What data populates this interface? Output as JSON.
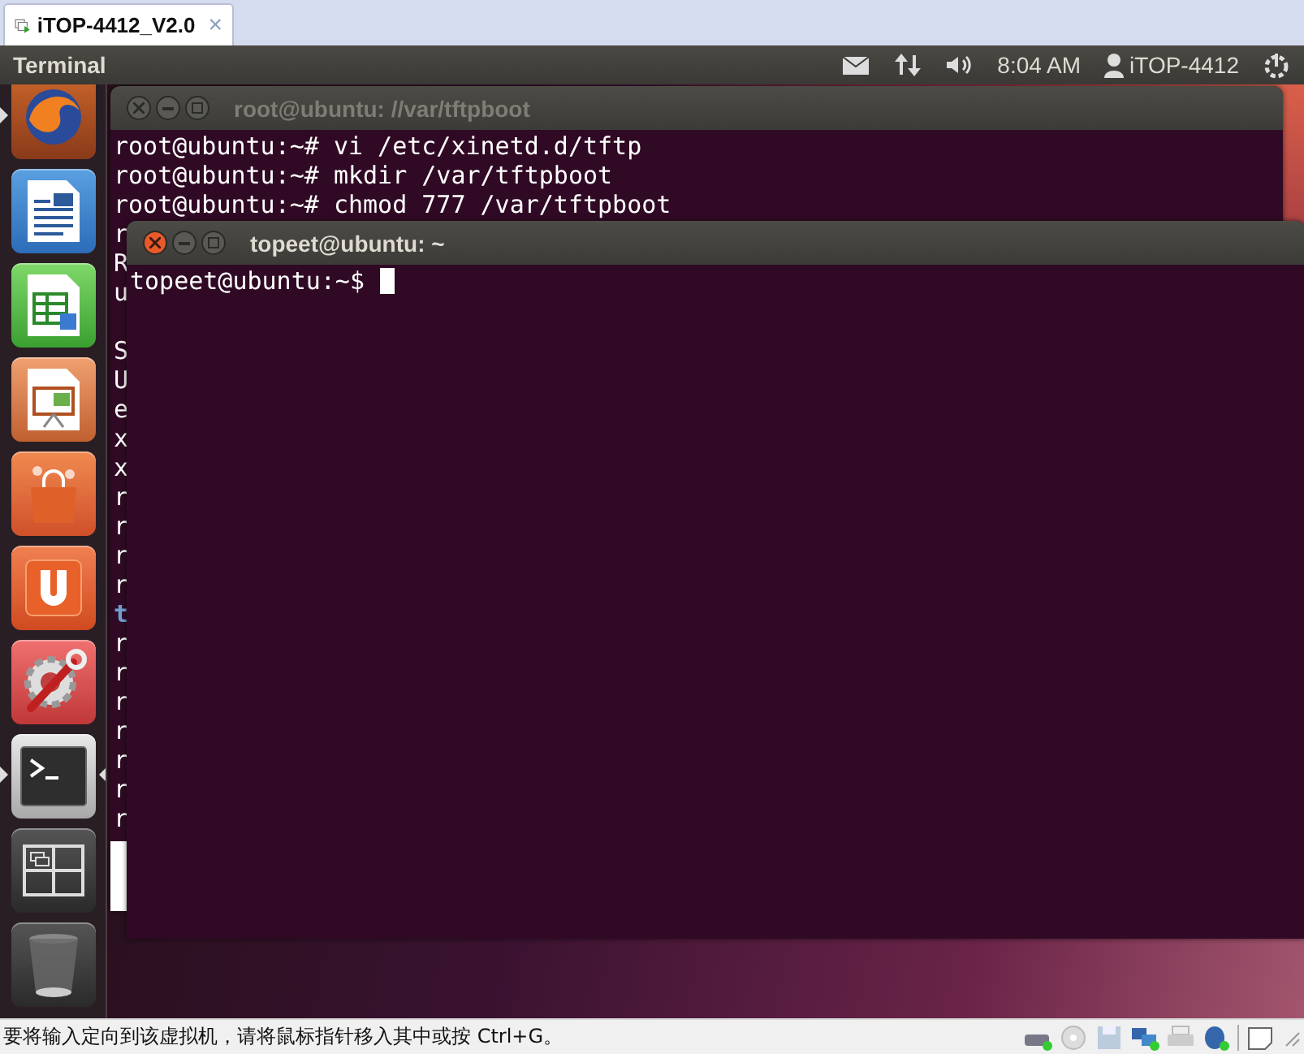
{
  "vm_tab": {
    "title": "iTOP-4412_V2.0",
    "close": "×"
  },
  "top_panel": {
    "app_title": "Terminal",
    "clock": "8:04 AM",
    "user": "iTOP-4412"
  },
  "launcher": [
    {
      "kind": "browser",
      "running": true,
      "focused": false
    },
    {
      "kind": "writer",
      "running": false,
      "focused": false
    },
    {
      "kind": "spreadsheet",
      "running": false,
      "focused": false
    },
    {
      "kind": "presentation",
      "running": false,
      "focused": false
    },
    {
      "kind": "store",
      "running": false,
      "focused": false
    },
    {
      "kind": "cloud",
      "running": false,
      "focused": false
    },
    {
      "kind": "settings",
      "running": false,
      "focused": false
    },
    {
      "kind": "terminal",
      "running": true,
      "focused": true
    },
    {
      "kind": "workspaces",
      "running": false,
      "focused": false
    },
    {
      "kind": "trash",
      "running": false,
      "focused": false
    }
  ],
  "windows": [
    {
      "title": "root@ubuntu: //var/tftpboot",
      "focused": false,
      "blocks": [
        {
          "lines": [
            {
              "text": "root@ubuntu:~# vi /etc/xinetd.d/tftp",
              "highlighted": false
            },
            {
              "text": "root@ubuntu:~# mkdir /var/tftpboot",
              "highlighted": false
            },
            {
              "text": "root@ubuntu:~# chmod 777 /var/tftpboot",
              "highlighted": false
            },
            {
              "text": "r",
              "highlighted": false
            },
            {
              "text": "R",
              "highlighted": false
            },
            {
              "text": "u",
              "highlighted": false
            }
          ]
        },
        {
          "lines": [
            {
              "text": "S",
              "highlighted": false
            },
            {
              "text": "U",
              "highlighted": false
            },
            {
              "text": "e",
              "highlighted": false
            },
            {
              "text": "x",
              "highlighted": false
            },
            {
              "text": "x",
              "highlighted": false
            },
            {
              "text": "r",
              "highlighted": false
            },
            {
              "text": "r",
              "highlighted": false
            },
            {
              "text": "r",
              "highlighted": false
            },
            {
              "text": "r",
              "highlighted": false
            },
            {
              "text": "t",
              "highlighted": true
            },
            {
              "text": "r",
              "highlighted": false
            },
            {
              "text": "r",
              "highlighted": false
            },
            {
              "text": "r",
              "highlighted": false
            },
            {
              "text": "r",
              "highlighted": false
            },
            {
              "text": "r",
              "highlighted": false
            },
            {
              "text": "r",
              "highlighted": false
            },
            {
              "text": "r",
              "highlighted": false
            }
          ]
        }
      ]
    },
    {
      "title": "topeet@ubuntu: ~",
      "focused": true,
      "prompt": "topeet@ubuntu:~$"
    }
  ],
  "status_bar": {
    "message": "要将输入定向到该虚拟机，请将鼠标指针移入其中或按 Ctrl+G。"
  }
}
